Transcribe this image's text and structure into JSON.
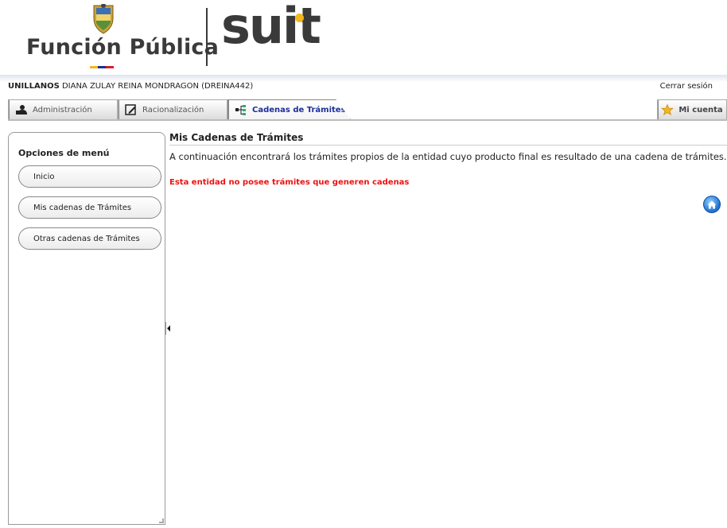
{
  "header": {
    "org_logo_text": "Función Pública",
    "product_logo_text": "suit",
    "org_underline_colors": [
      "#f3b81a",
      "#1c2f9b",
      "#d5202b"
    ]
  },
  "userbar": {
    "entity": "UNILLANOS",
    "user": "DIANA ZULAY REINA MONDRAGON (DREINA442)",
    "logout_label": "Cerrar sesión"
  },
  "tabs": [
    {
      "label": "Administración",
      "icon": "admin-icon"
    },
    {
      "label": "Racionalización",
      "icon": "edit-icon"
    },
    {
      "label": "Cadenas de Trámites",
      "icon": "chain-icon",
      "active": true
    },
    {
      "label": "Mi cuenta",
      "icon": "star-icon"
    }
  ],
  "sidebar": {
    "title": "Opciones de menú",
    "items": [
      {
        "label": "Inicio"
      },
      {
        "label": "Mis cadenas de Trámites"
      },
      {
        "label": "Otras cadenas de Trámites"
      }
    ]
  },
  "main": {
    "title": "Mis Cadenas de Trámites",
    "description": "A continuación encontrará los trámites propios de la entidad cuyo producto final es resultado de una cadena de trámites.",
    "alert": "Esta entidad no posee trámites que generen cadenas",
    "home_icon": "home-icon"
  },
  "colors": {
    "active_tab_text": "#1c2f9b",
    "alert": "#e11111",
    "logo_dark": "#3a3a3a",
    "logo_accent": "#f3b81a"
  }
}
